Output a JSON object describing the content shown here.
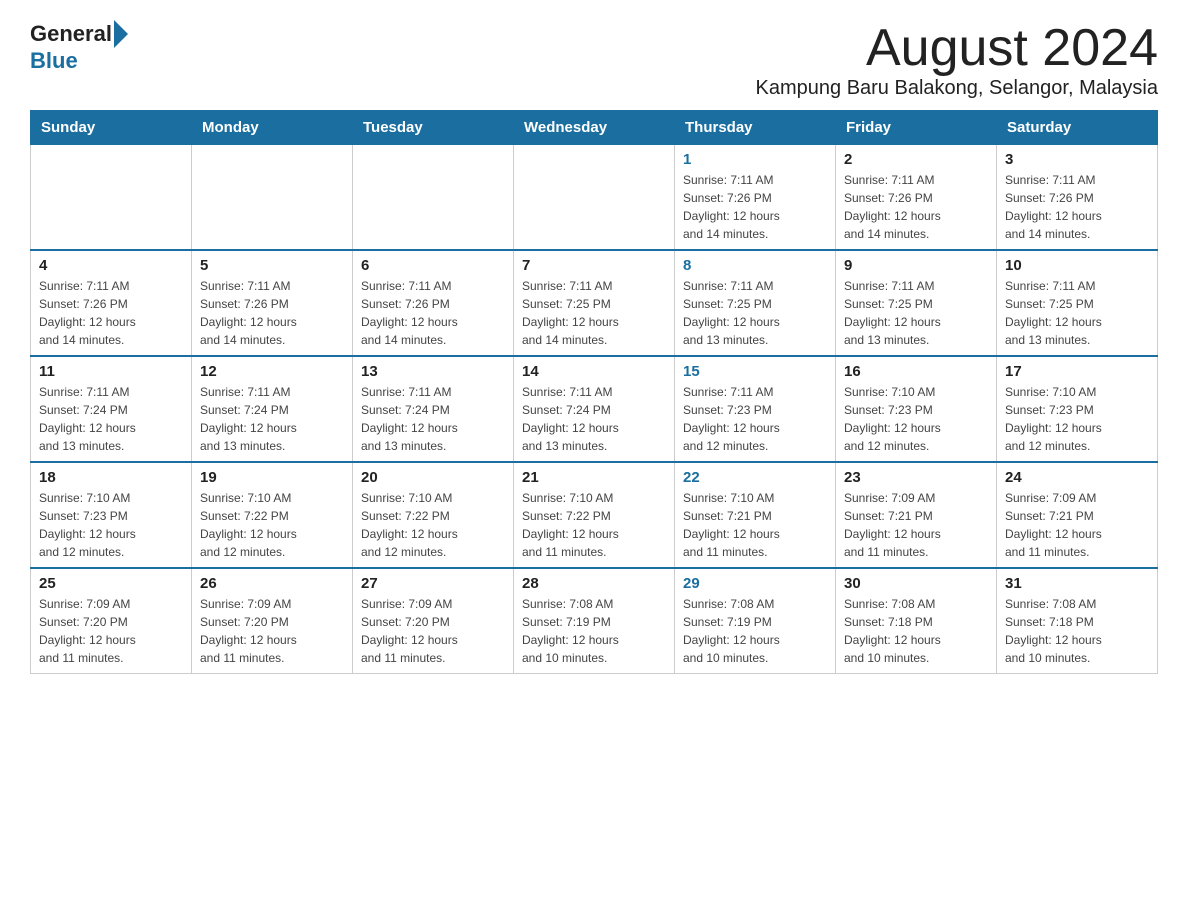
{
  "header": {
    "logo_general": "General",
    "logo_blue": "Blue",
    "month_year": "August 2024",
    "location": "Kampung Baru Balakong, Selangor, Malaysia"
  },
  "columns": [
    "Sunday",
    "Monday",
    "Tuesday",
    "Wednesday",
    "Thursday",
    "Friday",
    "Saturday"
  ],
  "weeks": [
    {
      "days": [
        {
          "num": "",
          "info": ""
        },
        {
          "num": "",
          "info": ""
        },
        {
          "num": "",
          "info": ""
        },
        {
          "num": "",
          "info": ""
        },
        {
          "num": "1",
          "info": "Sunrise: 7:11 AM\nSunset: 7:26 PM\nDaylight: 12 hours\nand 14 minutes."
        },
        {
          "num": "2",
          "info": "Sunrise: 7:11 AM\nSunset: 7:26 PM\nDaylight: 12 hours\nand 14 minutes."
        },
        {
          "num": "3",
          "info": "Sunrise: 7:11 AM\nSunset: 7:26 PM\nDaylight: 12 hours\nand 14 minutes."
        }
      ]
    },
    {
      "days": [
        {
          "num": "4",
          "info": "Sunrise: 7:11 AM\nSunset: 7:26 PM\nDaylight: 12 hours\nand 14 minutes."
        },
        {
          "num": "5",
          "info": "Sunrise: 7:11 AM\nSunset: 7:26 PM\nDaylight: 12 hours\nand 14 minutes."
        },
        {
          "num": "6",
          "info": "Sunrise: 7:11 AM\nSunset: 7:26 PM\nDaylight: 12 hours\nand 14 minutes."
        },
        {
          "num": "7",
          "info": "Sunrise: 7:11 AM\nSunset: 7:25 PM\nDaylight: 12 hours\nand 14 minutes."
        },
        {
          "num": "8",
          "info": "Sunrise: 7:11 AM\nSunset: 7:25 PM\nDaylight: 12 hours\nand 13 minutes."
        },
        {
          "num": "9",
          "info": "Sunrise: 7:11 AM\nSunset: 7:25 PM\nDaylight: 12 hours\nand 13 minutes."
        },
        {
          "num": "10",
          "info": "Sunrise: 7:11 AM\nSunset: 7:25 PM\nDaylight: 12 hours\nand 13 minutes."
        }
      ]
    },
    {
      "days": [
        {
          "num": "11",
          "info": "Sunrise: 7:11 AM\nSunset: 7:24 PM\nDaylight: 12 hours\nand 13 minutes."
        },
        {
          "num": "12",
          "info": "Sunrise: 7:11 AM\nSunset: 7:24 PM\nDaylight: 12 hours\nand 13 minutes."
        },
        {
          "num": "13",
          "info": "Sunrise: 7:11 AM\nSunset: 7:24 PM\nDaylight: 12 hours\nand 13 minutes."
        },
        {
          "num": "14",
          "info": "Sunrise: 7:11 AM\nSunset: 7:24 PM\nDaylight: 12 hours\nand 13 minutes."
        },
        {
          "num": "15",
          "info": "Sunrise: 7:11 AM\nSunset: 7:23 PM\nDaylight: 12 hours\nand 12 minutes."
        },
        {
          "num": "16",
          "info": "Sunrise: 7:10 AM\nSunset: 7:23 PM\nDaylight: 12 hours\nand 12 minutes."
        },
        {
          "num": "17",
          "info": "Sunrise: 7:10 AM\nSunset: 7:23 PM\nDaylight: 12 hours\nand 12 minutes."
        }
      ]
    },
    {
      "days": [
        {
          "num": "18",
          "info": "Sunrise: 7:10 AM\nSunset: 7:23 PM\nDaylight: 12 hours\nand 12 minutes."
        },
        {
          "num": "19",
          "info": "Sunrise: 7:10 AM\nSunset: 7:22 PM\nDaylight: 12 hours\nand 12 minutes."
        },
        {
          "num": "20",
          "info": "Sunrise: 7:10 AM\nSunset: 7:22 PM\nDaylight: 12 hours\nand 12 minutes."
        },
        {
          "num": "21",
          "info": "Sunrise: 7:10 AM\nSunset: 7:22 PM\nDaylight: 12 hours\nand 11 minutes."
        },
        {
          "num": "22",
          "info": "Sunrise: 7:10 AM\nSunset: 7:21 PM\nDaylight: 12 hours\nand 11 minutes."
        },
        {
          "num": "23",
          "info": "Sunrise: 7:09 AM\nSunset: 7:21 PM\nDaylight: 12 hours\nand 11 minutes."
        },
        {
          "num": "24",
          "info": "Sunrise: 7:09 AM\nSunset: 7:21 PM\nDaylight: 12 hours\nand 11 minutes."
        }
      ]
    },
    {
      "days": [
        {
          "num": "25",
          "info": "Sunrise: 7:09 AM\nSunset: 7:20 PM\nDaylight: 12 hours\nand 11 minutes."
        },
        {
          "num": "26",
          "info": "Sunrise: 7:09 AM\nSunset: 7:20 PM\nDaylight: 12 hours\nand 11 minutes."
        },
        {
          "num": "27",
          "info": "Sunrise: 7:09 AM\nSunset: 7:20 PM\nDaylight: 12 hours\nand 11 minutes."
        },
        {
          "num": "28",
          "info": "Sunrise: 7:08 AM\nSunset: 7:19 PM\nDaylight: 12 hours\nand 10 minutes."
        },
        {
          "num": "29",
          "info": "Sunrise: 7:08 AM\nSunset: 7:19 PM\nDaylight: 12 hours\nand 10 minutes."
        },
        {
          "num": "30",
          "info": "Sunrise: 7:08 AM\nSunset: 7:18 PM\nDaylight: 12 hours\nand 10 minutes."
        },
        {
          "num": "31",
          "info": "Sunrise: 7:08 AM\nSunset: 7:18 PM\nDaylight: 12 hours\nand 10 minutes."
        }
      ]
    }
  ]
}
